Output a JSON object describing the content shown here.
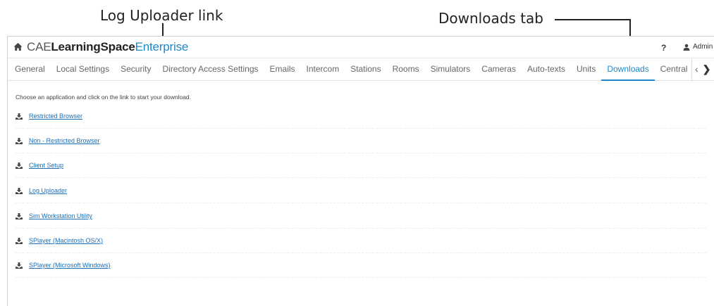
{
  "annotations": {
    "log_uploader_link": "Log Uploader link",
    "downloads_tab": "Downloads tab"
  },
  "header": {
    "brand_prefix": "CAE",
    "brand_main": "LearningSpace",
    "brand_suffix": "Enterprise",
    "help": "?",
    "user": "Admin"
  },
  "tabs": [
    {
      "label": "General"
    },
    {
      "label": "Local Settings"
    },
    {
      "label": "Security"
    },
    {
      "label": "Directory Access Settings"
    },
    {
      "label": "Emails"
    },
    {
      "label": "Intercom"
    },
    {
      "label": "Stations"
    },
    {
      "label": "Rooms"
    },
    {
      "label": "Simulators"
    },
    {
      "label": "Cameras"
    },
    {
      "label": "Auto-texts"
    },
    {
      "label": "Units"
    },
    {
      "label": "Downloads"
    },
    {
      "label": "Central"
    }
  ],
  "active_tab": "Downloads",
  "content": {
    "intro": "Choose an application and click on the link to start your download.",
    "downloads": [
      {
        "label": "Restricted Browser"
      },
      {
        "label": "Non - Restricted Browser"
      },
      {
        "label": "Client Setup"
      },
      {
        "label": "Log Uploader"
      },
      {
        "label": "Sim Workstation Utility"
      },
      {
        "label": "SPlayer (Macintosh OS/X)"
      },
      {
        "label": "SPlayer (Microsoft Windows)"
      }
    ]
  },
  "colors": {
    "accent": "#1e88c7",
    "link": "#1e6fb5"
  },
  "icons": {
    "home": "home-icon",
    "user": "user-icon",
    "download": "download-icon",
    "prev": "chevron-left-icon",
    "next": "chevron-right-icon"
  }
}
